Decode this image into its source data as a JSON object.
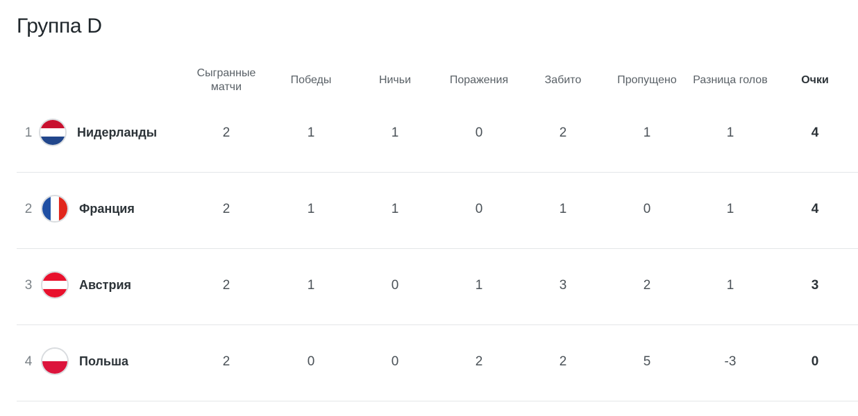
{
  "title": "Группа D",
  "headers": {
    "played": "Сыгранные матчи",
    "wins": "Победы",
    "draws": "Ничьи",
    "losses": "Поражения",
    "scored": "Забито",
    "conceded": "Пропущено",
    "goal_diff": "Разница голов",
    "points": "Очки"
  },
  "rows": [
    {
      "rank": "1",
      "team": "Нидерланды",
      "flag": "netherlands-flag-icon",
      "played": "2",
      "wins": "1",
      "draws": "1",
      "losses": "0",
      "scored": "2",
      "conceded": "1",
      "goal_diff": "1",
      "points": "4"
    },
    {
      "rank": "2",
      "team": "Франция",
      "flag": "france-flag-icon",
      "played": "2",
      "wins": "1",
      "draws": "1",
      "losses": "0",
      "scored": "1",
      "conceded": "0",
      "goal_diff": "1",
      "points": "4"
    },
    {
      "rank": "3",
      "team": "Австрия",
      "flag": "austria-flag-icon",
      "played": "2",
      "wins": "1",
      "draws": "0",
      "losses": "1",
      "scored": "3",
      "conceded": "2",
      "goal_diff": "1",
      "points": "3"
    },
    {
      "rank": "4",
      "team": "Польша",
      "flag": "poland-flag-icon",
      "played": "2",
      "wins": "0",
      "draws": "0",
      "losses": "2",
      "scored": "2",
      "conceded": "5",
      "goal_diff": "-3",
      "points": "0"
    }
  ],
  "colors": {
    "netherlands": [
      "#c8102e",
      "#ffffff",
      "#21468b"
    ],
    "france": [
      "#1f4fa3",
      "#ffffff",
      "#e1261c"
    ],
    "austria": [
      "#e8112d",
      "#ffffff",
      "#e8112d"
    ],
    "poland": [
      "#ffffff",
      "#dc143c"
    ]
  }
}
